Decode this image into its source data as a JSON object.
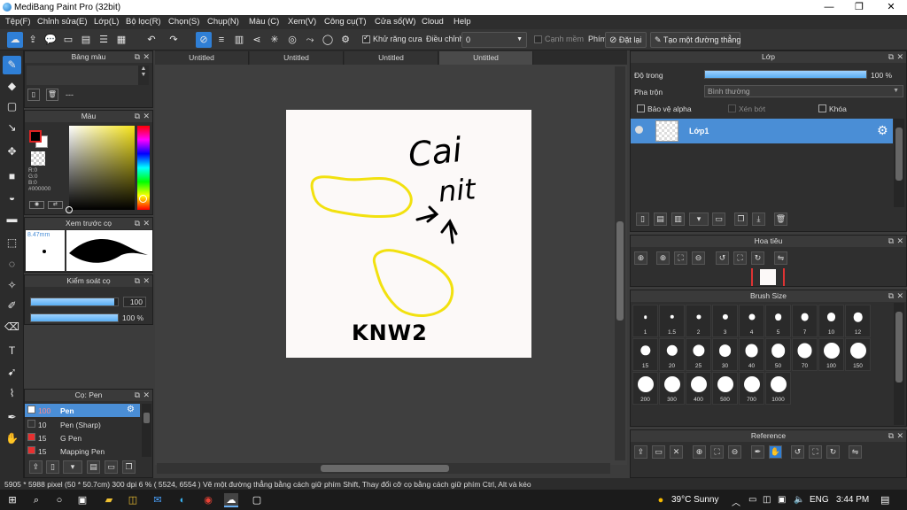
{
  "app": {
    "title": "MediBang Paint Pro (32bit)"
  },
  "window_controls": {
    "minimize": "—",
    "maximize": "❐",
    "close": "✕"
  },
  "menu": [
    "Tệp(F)",
    "Chỉnh sửa(E)",
    "Lớp(L)",
    "Bộ lọc(R)",
    "Chọn(S)",
    "Chụp(N)",
    "Màu (C)",
    "Xem(V)",
    "Công cụ(T)",
    "Cửa sổ(W)",
    "Cloud",
    "Help"
  ],
  "toolbar": {
    "antialias_label": "Khử răng cưa",
    "antialias_checked": true,
    "adjust_label": "Điều chỉnh",
    "adjust_value": "0",
    "edge_label": "Cạnh mềm",
    "key_label": "Phím",
    "reset_label": "Đặt lại",
    "straight_line_label": "Tạo một đường thẳng"
  },
  "panels": {
    "palette": {
      "title": "Bảng màu",
      "dashes": "---"
    },
    "color": {
      "title": "Màu",
      "r": "R:0",
      "g": "G:0",
      "b": "B:0",
      "hex": "#000000",
      "primary": "#000000",
      "secondary": "#ffffff"
    },
    "brush_preview": {
      "title": "Xem trước cọ",
      "size": "8.47mm"
    },
    "brush_control": {
      "title": "Kiểm soát cọ",
      "size_value": "100",
      "opacity_value": "100 %",
      "size_fraction": 0.96,
      "opacity_fraction": 1.0
    },
    "brushes": {
      "title": "Cọ: Pen",
      "items": [
        {
          "size": "100",
          "name": "Pen",
          "color": "#ffffff",
          "selected": true
        },
        {
          "size": "10",
          "name": "Pen (Sharp)",
          "color": "#333333",
          "selected": false
        },
        {
          "size": "15",
          "name": "G Pen",
          "color": "#e83030",
          "selected": false
        },
        {
          "size": "15",
          "name": "Mapping Pen",
          "color": "#e83030",
          "selected": false
        }
      ]
    }
  },
  "tabs": [
    "Untitled",
    "Untitled",
    "Untitled",
    "Untitled"
  ],
  "active_tab": 3,
  "canvas": {
    "text_top_1": "Cai",
    "text_top_2": "nit",
    "text_bottom": "KNW2"
  },
  "layers": {
    "title": "Lớp",
    "opacity_label": "Độ trong",
    "opacity_value": "100 %",
    "opacity_fraction": 1.0,
    "blend_label": "Pha trộn",
    "blend_value": "Bình thường",
    "protect_alpha": "Bảo vệ alpha",
    "clip": "Xén bớt",
    "lock": "Khóa",
    "layer_name": "Lớp1"
  },
  "navigator": {
    "title": "Hoa tiêu"
  },
  "brush_size": {
    "title": "Brush Size",
    "sizes": [
      "1",
      "1.5",
      "2",
      "3",
      "4",
      "5",
      "7",
      "10",
      "12",
      "15",
      "20",
      "25",
      "30",
      "40",
      "50",
      "70",
      "100",
      "150",
      "200",
      "300",
      "400",
      "500",
      "700",
      "1000"
    ]
  },
  "reference": {
    "title": "Reference"
  },
  "status": {
    "text": "5905 * 5988 pixel   (50 * 50.7cm)   300 dpi   6 %   ( 5524, 6554 )   Vẽ một đường thẳng bằng cách giữ phím Shift, Thay đổi cỡ cọ bằng cách giữ phím Ctrl, Alt và kéo"
  },
  "taskbar": {
    "weather": "39°C  Sunny",
    "lang": "ENG",
    "time": "3:44 PM"
  },
  "colors": {
    "accent": "#2f7fd6",
    "stroke_yellow": "#f2e10f"
  }
}
